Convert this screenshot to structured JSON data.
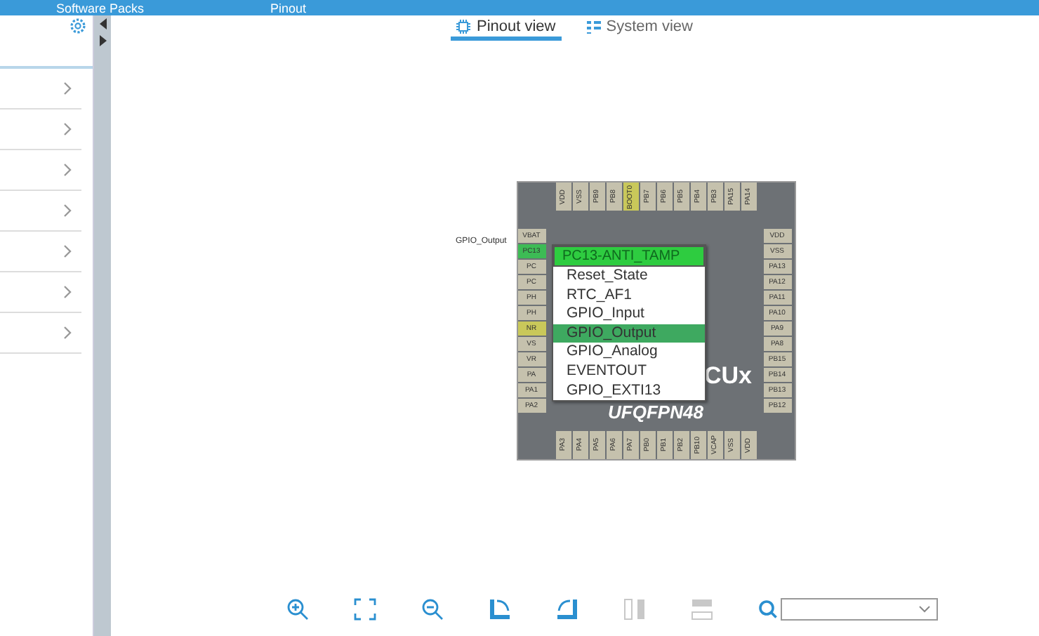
{
  "header": {
    "breadcrumbs": [
      "Software Packs",
      "Pinout"
    ]
  },
  "sidebar": {
    "items": [
      {
        "expanded": false
      },
      {
        "expanded": false
      },
      {
        "expanded": false
      },
      {
        "expanded": false
      },
      {
        "expanded": false
      },
      {
        "expanded": false
      },
      {
        "expanded": false
      }
    ]
  },
  "tabs": [
    {
      "label": "Pinout view",
      "selected": true
    },
    {
      "label": "System view",
      "selected": false
    }
  ],
  "chip": {
    "logo": "CUx",
    "package": "UFQFPN48",
    "pin_label": "GPIO_Output",
    "pins": {
      "top": [
        {
          "label": "VDD"
        },
        {
          "label": "VSS"
        },
        {
          "label": "PB9"
        },
        {
          "label": "PB8"
        },
        {
          "label": "BOOT0",
          "color": "#c9c85a"
        },
        {
          "label": "PB7"
        },
        {
          "label": "PB6"
        },
        {
          "label": "PB5"
        },
        {
          "label": "PB4"
        },
        {
          "label": "PB3"
        },
        {
          "label": "PA15"
        },
        {
          "label": "PA14"
        }
      ],
      "left": [
        {
          "label": "VBAT"
        },
        {
          "label": "PC13",
          "color": "#3dbb55"
        },
        {
          "label": "PC"
        },
        {
          "label": "PC"
        },
        {
          "label": "PH"
        },
        {
          "label": "PH"
        },
        {
          "label": "NR",
          "color": "#c9c85a"
        },
        {
          "label": "VS"
        },
        {
          "label": "VR"
        },
        {
          "label": "PA"
        },
        {
          "label": "PA1"
        },
        {
          "label": "PA2"
        }
      ],
      "right": [
        {
          "label": "VDD"
        },
        {
          "label": "VSS"
        },
        {
          "label": "PA13"
        },
        {
          "label": "PA12"
        },
        {
          "label": "PA11"
        },
        {
          "label": "PA10"
        },
        {
          "label": "PA9"
        },
        {
          "label": "PA8"
        },
        {
          "label": "PB15"
        },
        {
          "label": "PB14"
        },
        {
          "label": "PB13"
        },
        {
          "label": "PB12"
        }
      ],
      "bottom": [
        {
          "label": "PA3"
        },
        {
          "label": "PA4"
        },
        {
          "label": "PA5"
        },
        {
          "label": "PA6"
        },
        {
          "label": "PA7"
        },
        {
          "label": "PB0"
        },
        {
          "label": "PB1"
        },
        {
          "label": "PB2"
        },
        {
          "label": "PB10"
        },
        {
          "label": "VCAP"
        },
        {
          "label": "VSS"
        },
        {
          "label": "VDD"
        }
      ]
    }
  },
  "menu": {
    "title": "PC13-ANTI_TAMP",
    "items": [
      {
        "label": "Reset_State",
        "selected": false
      },
      {
        "label": "RTC_AF1",
        "selected": false
      },
      {
        "label": "GPIO_Input",
        "selected": false
      },
      {
        "label": "GPIO_Output",
        "selected": true
      },
      {
        "label": "GPIO_Analog",
        "selected": false
      },
      {
        "label": "EVENTOUT",
        "selected": false
      },
      {
        "label": "GPIO_EXTI13",
        "selected": false
      }
    ]
  },
  "toolbar": [
    {
      "kind": "zoom-in",
      "disabled": false
    },
    {
      "kind": "fit",
      "disabled": false
    },
    {
      "kind": "zoom-out",
      "disabled": false
    },
    {
      "kind": "rotate-right",
      "disabled": false
    },
    {
      "kind": "rotate-left",
      "disabled": false
    },
    {
      "kind": "split-vertical",
      "disabled": true
    },
    {
      "kind": "split-horizontal",
      "disabled": true
    }
  ]
}
